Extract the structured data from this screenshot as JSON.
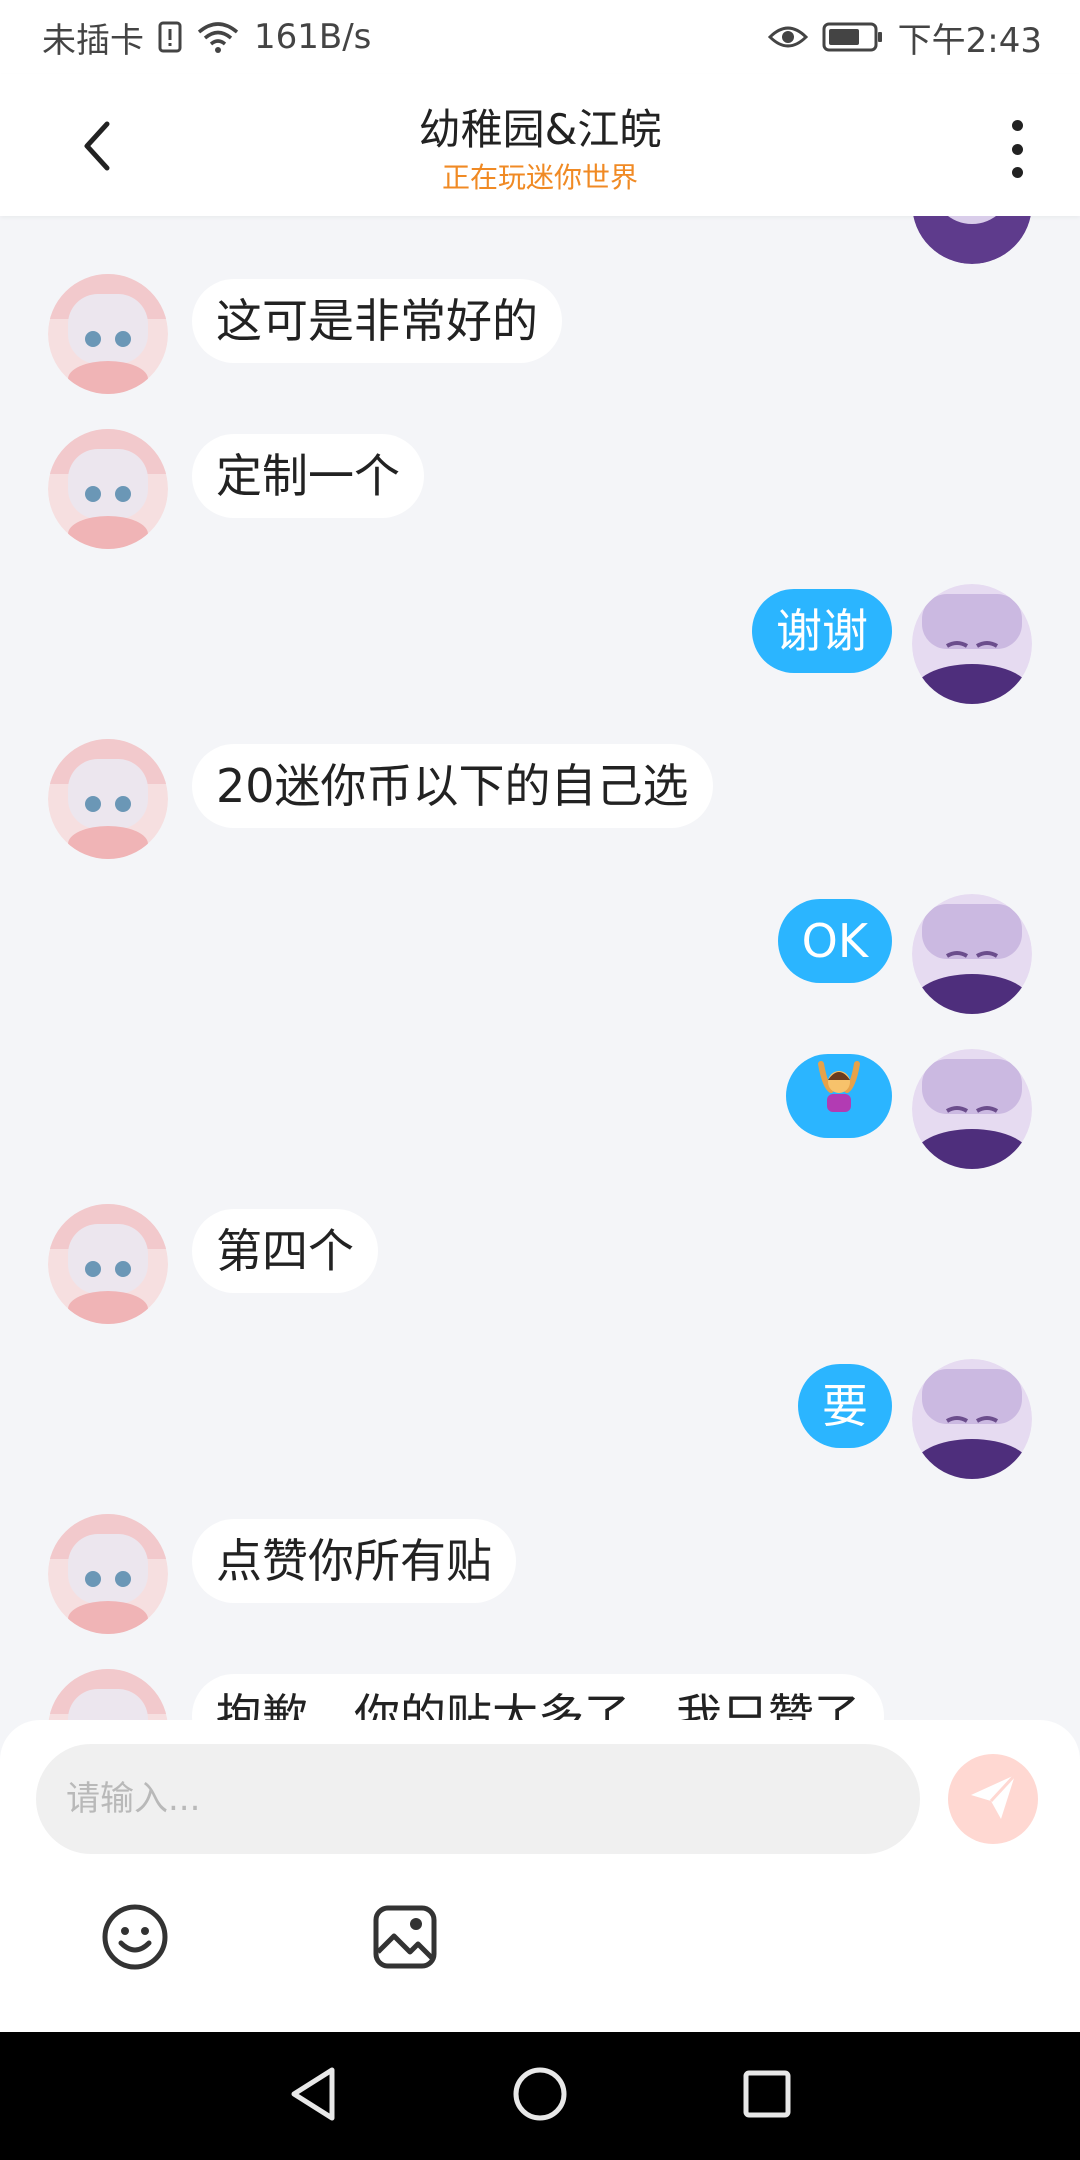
{
  "status_bar": {
    "carrier": "未插卡",
    "net_speed": "161B/s",
    "time": "下午2:43",
    "icons": [
      "sim-alert-icon",
      "wifi-icon",
      "eye-icon",
      "battery-icon"
    ]
  },
  "header": {
    "title": "幼稚园&江皖",
    "subtitle": "正在玩迷你世界",
    "back_icon": "chevron-left-icon",
    "more_icon": "more-vertical-icon"
  },
  "messages": [
    {
      "side": "left",
      "text": "这可是非常好的"
    },
    {
      "side": "left",
      "text": "定制一个"
    },
    {
      "side": "right",
      "text": "谢谢"
    },
    {
      "side": "left",
      "text": "20迷你币以下的自己选"
    },
    {
      "side": "right",
      "text": "OK"
    },
    {
      "side": "right",
      "emoji": "🙆‍♀️"
    },
    {
      "side": "left",
      "text": "第四个"
    },
    {
      "side": "right",
      "text": "要"
    },
    {
      "side": "left",
      "text": "点赞你所有贴"
    },
    {
      "side": "left",
      "text": "抱歉，你的贴太多了，我只赞了"
    }
  ],
  "input": {
    "placeholder": "请输入...",
    "send_icon": "send-icon",
    "emoji_button_icon": "smiley-icon",
    "image_button_icon": "image-icon"
  },
  "colors": {
    "accent_blue": "#2bb5ff",
    "subtitle_orange": "#f08a24",
    "send_disabled": "#ffd8d2",
    "chat_bg": "#f4f5f8"
  },
  "nav_bar": {
    "icons": [
      "back-triangle-icon",
      "home-circle-icon",
      "recents-square-icon"
    ]
  }
}
